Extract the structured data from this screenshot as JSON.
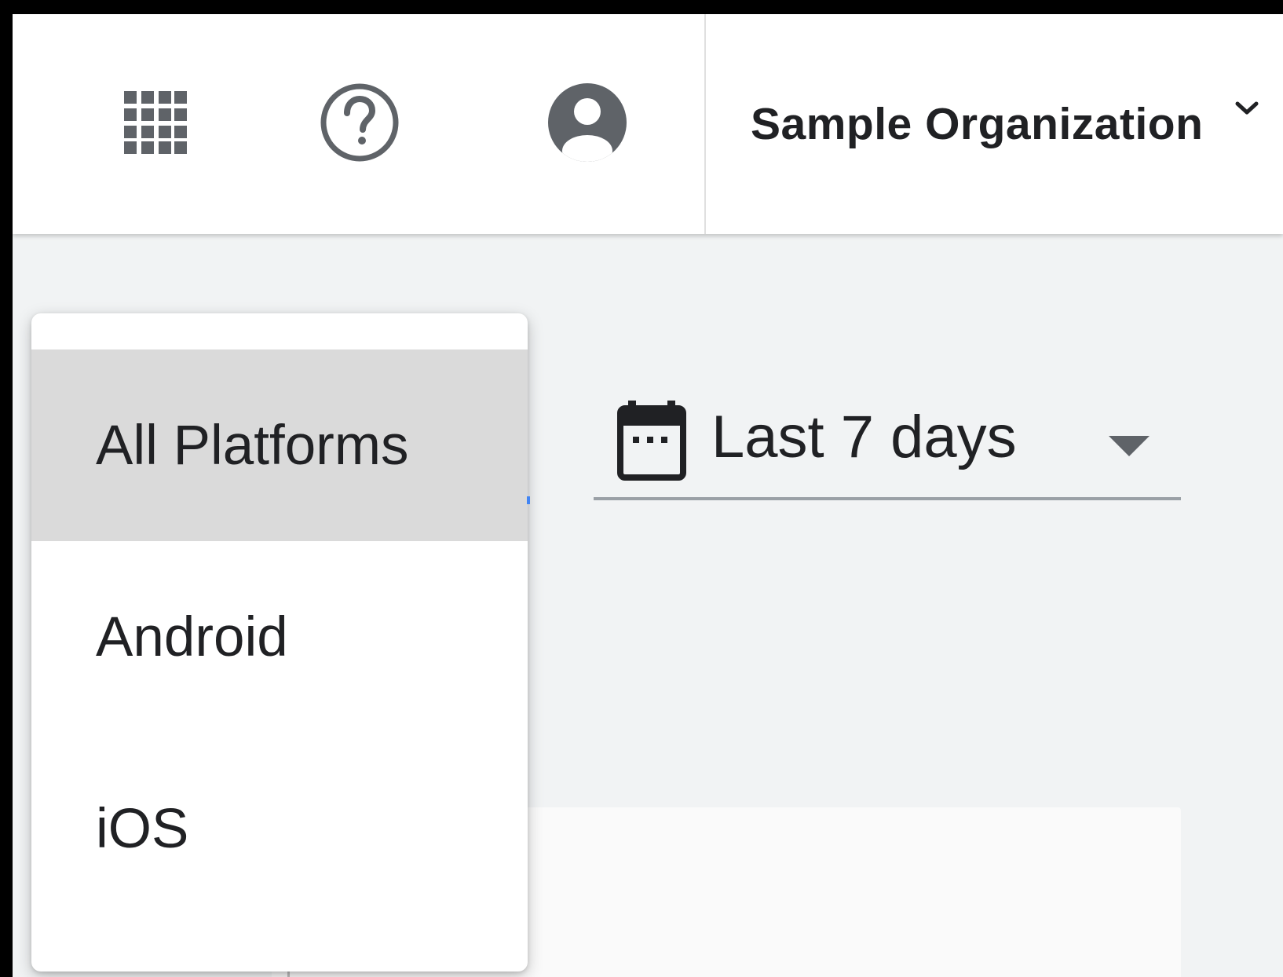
{
  "header": {
    "apps_icon": "apps-grid-icon",
    "help_icon": "help-circle-icon",
    "account_icon": "account-circle-icon",
    "organization": {
      "name": "Sample Organization",
      "chevron_icon": "chevron-down-icon"
    }
  },
  "filters": {
    "date_range": {
      "icon": "calendar-icon",
      "value": "Last 7 days",
      "caret_icon": "caret-down-icon"
    },
    "platform_menu": {
      "items": [
        {
          "label": "All Platforms",
          "selected": true
        },
        {
          "label": "Android",
          "selected": false
        },
        {
          "label": "iOS",
          "selected": false
        }
      ]
    }
  },
  "colors": {
    "background": "#f1f3f4",
    "surface": "#ffffff",
    "text": "#202124",
    "icon": "#5f6368",
    "selected_item": "#dadada",
    "underline": "#9aa0a6"
  }
}
